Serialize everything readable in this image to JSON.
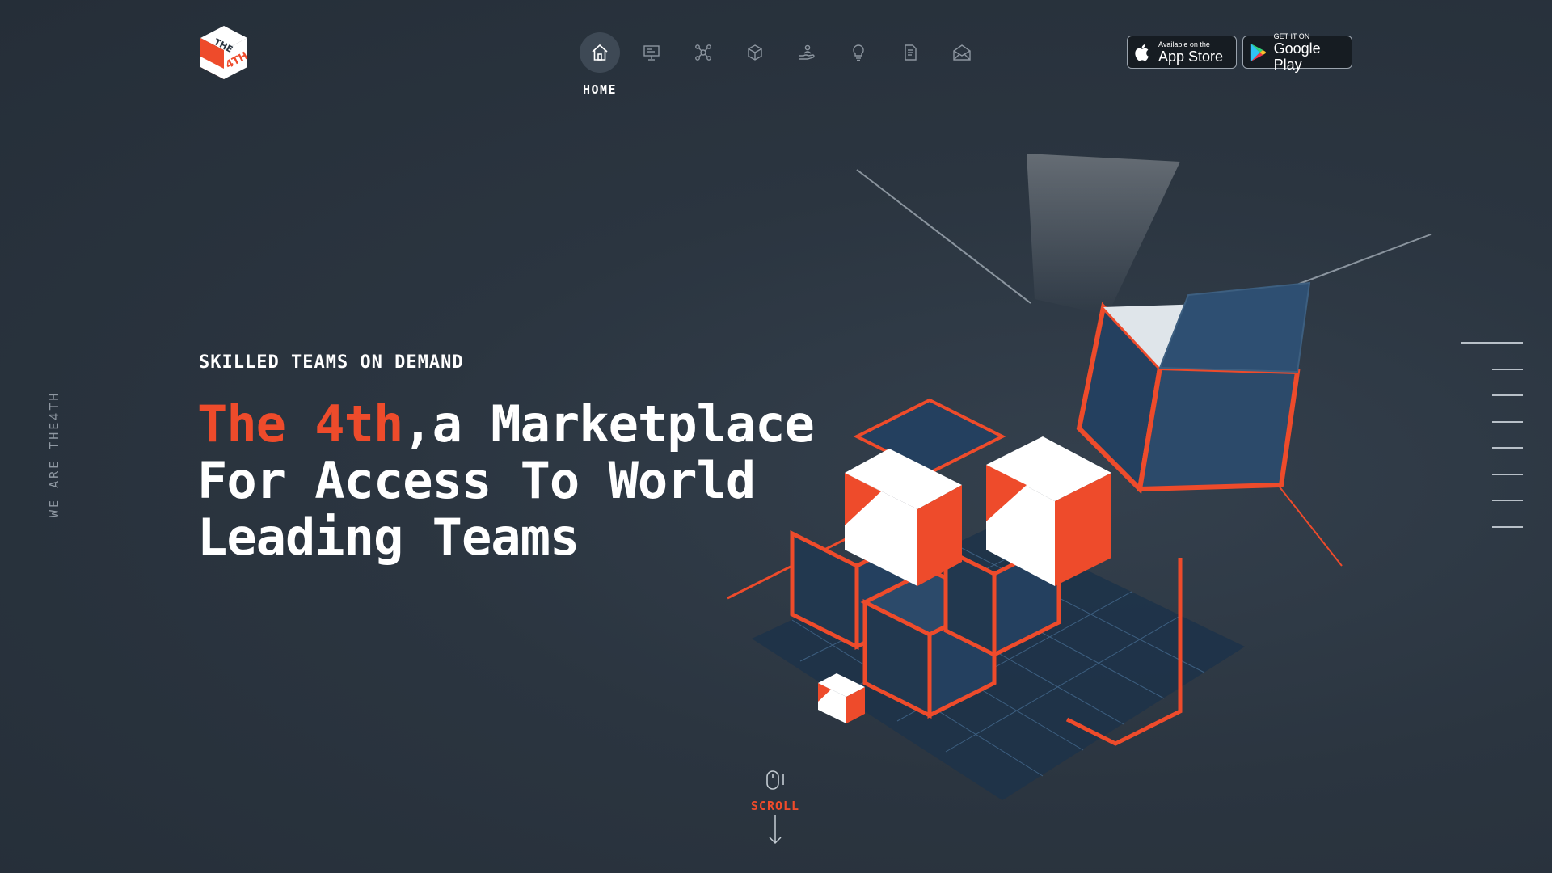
{
  "brand": {
    "logo_lines": [
      "THE",
      "4TH"
    ],
    "colors": {
      "accent": "#ee4b2b",
      "background": "#2b3540",
      "cube_face": "#24405f"
    }
  },
  "nav": {
    "items": [
      {
        "icon": "home-icon",
        "label": "HOME",
        "active": true
      },
      {
        "icon": "presentation-icon",
        "label": "",
        "active": false
      },
      {
        "icon": "network-icon",
        "label": "",
        "active": false
      },
      {
        "icon": "cube-icon",
        "label": "",
        "active": false
      },
      {
        "icon": "hand-user-icon",
        "label": "",
        "active": false
      },
      {
        "icon": "lightbulb-icon",
        "label": "",
        "active": false
      },
      {
        "icon": "document-icon",
        "label": "",
        "active": false
      },
      {
        "icon": "envelope-icon",
        "label": "",
        "active": false
      }
    ]
  },
  "stores": {
    "app_store": {
      "small": "Available on the",
      "big": "App Store",
      "icon": "apple-icon"
    },
    "google_play": {
      "small": "GET IT ON",
      "big": "Google Play",
      "icon": "google-play-icon"
    }
  },
  "side_text": "WE ARE THE4TH",
  "hero": {
    "eyebrow": "SKILLED TEAMS ON DEMAND",
    "headline_accent": "The 4th",
    "headline_line1_rest": ",a Marketplace",
    "headline_line2": "For Access To World",
    "headline_line3": "Leading Teams"
  },
  "section_lines": {
    "count": 8,
    "active_index": 0
  },
  "scroll": {
    "label": "SCROLL",
    "icon": "mouse-icon"
  }
}
